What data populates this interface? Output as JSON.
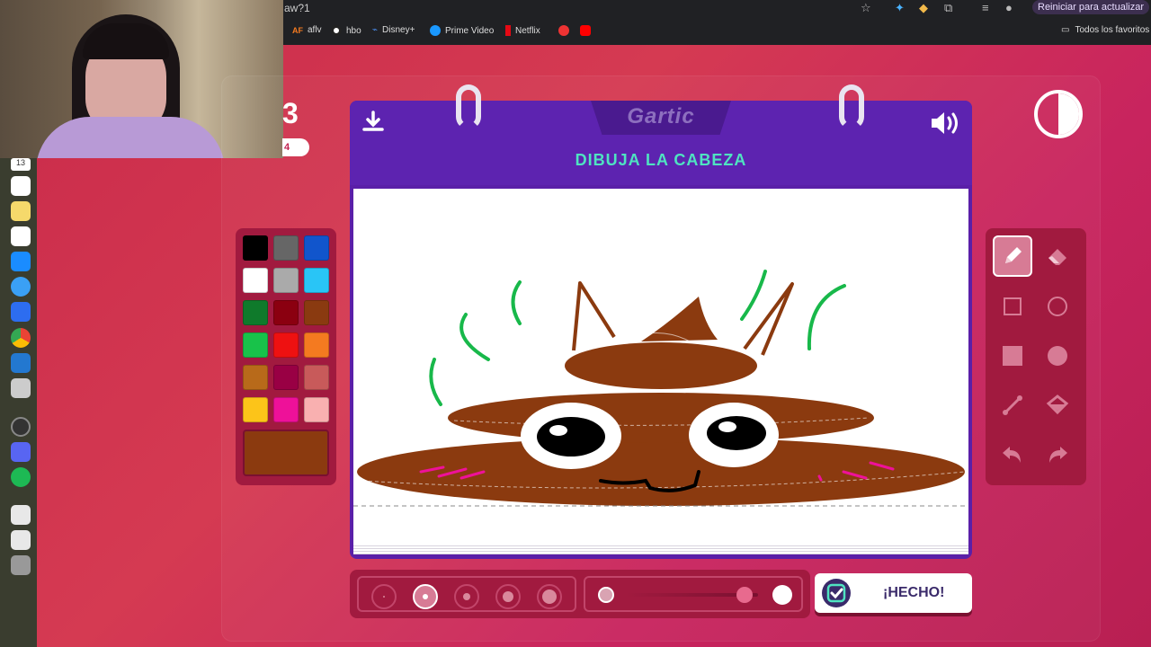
{
  "browser": {
    "url_fragment": "aw?1",
    "update_label": "Reiniciar para actualizar",
    "bookmarks": [
      {
        "label": "aflv",
        "badge": "AF"
      },
      {
        "label": "hbo"
      },
      {
        "label": "Disney+"
      },
      {
        "label": "Prime Video"
      },
      {
        "label": "Netflix"
      }
    ],
    "bookmarks_folder": "Todos los favoritos"
  },
  "dock": {
    "badge_count": "13"
  },
  "game": {
    "round_number": "3",
    "round_sub": "4",
    "logo": "Gartic",
    "instruction": "DIBUJA LA CABEZA",
    "done_label": "¡HECHO!"
  },
  "palette": {
    "colors": [
      "#000000",
      "#666666",
      "#1155cc",
      "#ffffff",
      "#aaaaaa",
      "#29c5f6",
      "#0f7a2b",
      "#8b0010",
      "#8a3a10",
      "#18c24a",
      "#ee1111",
      "#f47a20",
      "#b86a1a",
      "#990044",
      "#c85a5a",
      "#fcc419",
      "#ee1199",
      "#f9b0b0"
    ],
    "current_color": "#8b3a0f"
  },
  "tools": [
    "pencil",
    "eraser",
    "rectangle-outline",
    "ellipse-outline",
    "rectangle-filled",
    "ellipse-filled",
    "line",
    "fill-bucket",
    "undo",
    "redo"
  ],
  "thickness": {
    "options": 5,
    "selected_index": 1
  },
  "opacity": {
    "value": 0.9
  }
}
